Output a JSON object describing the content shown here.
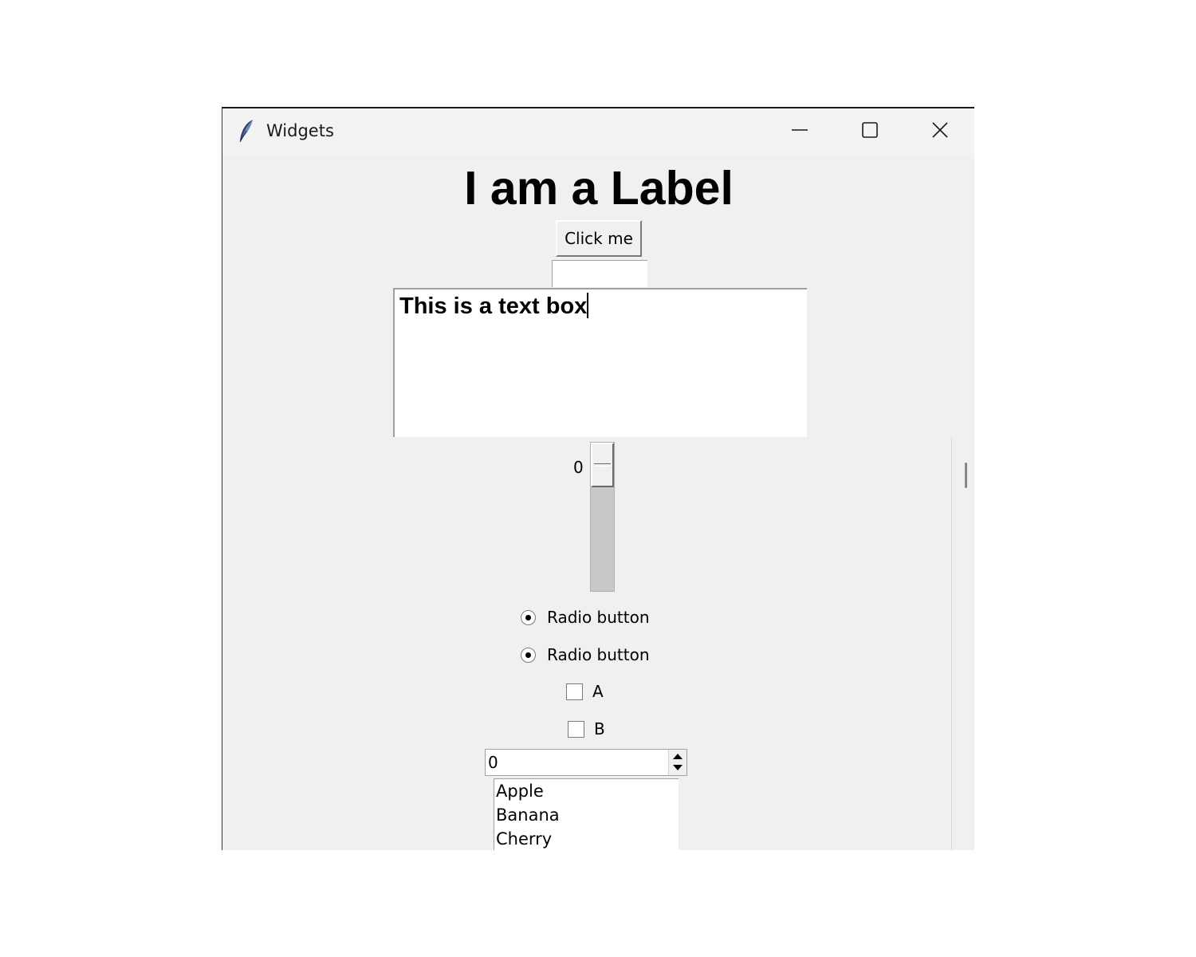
{
  "window": {
    "title": "Widgets",
    "app_icon": "feather-icon",
    "controls": [
      "minimize-icon",
      "maximize-icon",
      "close-icon"
    ]
  },
  "content": {
    "label_text": "I am a Label",
    "button_label": "Click me",
    "entry_value": "",
    "textbox_value": "This is a text box",
    "scale_value": "0",
    "radio_buttons": [
      {
        "label": "Radio button",
        "selected": true
      },
      {
        "label": "Radio button",
        "selected": true
      }
    ],
    "checkboxes": [
      {
        "label": "A",
        "checked": false
      },
      {
        "label": "B",
        "checked": false
      }
    ],
    "spinbox_value": "0",
    "listbox_items": [
      "Apple",
      "Banana",
      "Cherry"
    ]
  }
}
